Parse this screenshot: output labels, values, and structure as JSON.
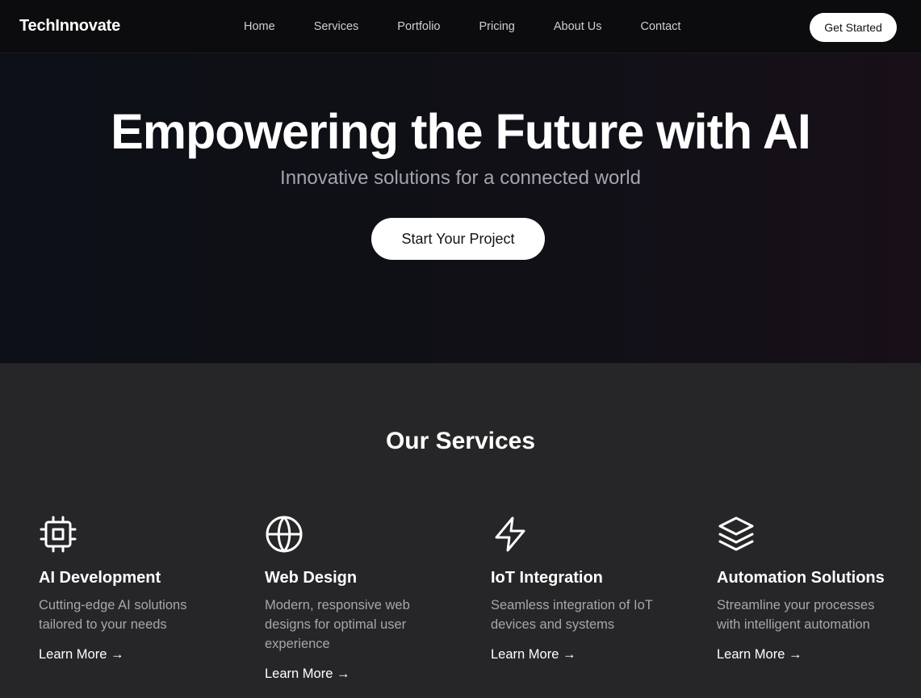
{
  "nav": {
    "brand": "TechInnovate",
    "links": [
      "Home",
      "Services",
      "Portfolio",
      "Pricing",
      "About Us",
      "Contact"
    ],
    "cta": "Get Started"
  },
  "hero": {
    "title": "Empowering the Future with AI",
    "subtitle": "Innovative solutions for a connected world",
    "button": "Start Your Project"
  },
  "services": {
    "title": "Our Services",
    "items": [
      {
        "icon": "cpu-icon",
        "title": "AI Development",
        "description": "Cutting-edge AI solutions tailored to your needs",
        "link": "Learn More →"
      },
      {
        "icon": "globe-icon",
        "title": "Web Design",
        "description": "Modern, responsive web designs for optimal user experience",
        "link": "Learn More →"
      },
      {
        "icon": "lightning-icon",
        "title": "IoT Integration",
        "description": "Seamless integration of IoT devices and systems",
        "link": "Learn More →"
      },
      {
        "icon": "layers-icon",
        "title": "Automation Solutions",
        "description": "Streamline your processes with intelligent automation",
        "link": "Learn More →"
      }
    ]
  },
  "colors": {
    "nav_bg": "#0c0c0e",
    "hero_bg_start": "#0c0f17",
    "hero_bg_end": "#180f18",
    "section_bg": "#262628",
    "muted_text": "#a6a6ad",
    "button_bg": "#ffffff"
  }
}
